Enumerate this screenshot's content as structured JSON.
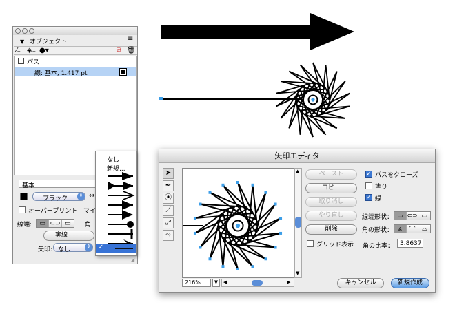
{
  "object_panel": {
    "title": "オブジェクト",
    "path_label": "パス",
    "stroke_label": "線: 基本, 1.417 pt",
    "style_label": "基本",
    "color_select": "ブラック",
    "overprint_label": "オーバープリント",
    "miter_label": "マイ",
    "cap_label": "線端:",
    "corner_label": "角:",
    "line_style": "実線",
    "arrow_label": "矢印:",
    "arrow_value": "なし"
  },
  "arrow_menu": {
    "items": [
      "なし",
      "新規..."
    ]
  },
  "arrow_editor": {
    "title": "矢印エディタ",
    "zoom": "216%",
    "buttons": {
      "paste": "ペースト",
      "copy": "コピー",
      "undo": "取り消し",
      "redo": "やり直し",
      "delete": "削除",
      "cancel": "キャンセル",
      "new": "新規作成"
    },
    "close_path_label": "パスをクローズ",
    "close_path_checked": true,
    "fill_label": "塗り",
    "fill_checked": false,
    "stroke_label": "線",
    "stroke_checked": true,
    "end_shape_label": "線端形状：",
    "corner_shape_label": "角の形状：",
    "grid_label": "グリッド表示",
    "grid_checked": false,
    "ratio_label": "角の比率：",
    "ratio_value": "3.8637"
  }
}
